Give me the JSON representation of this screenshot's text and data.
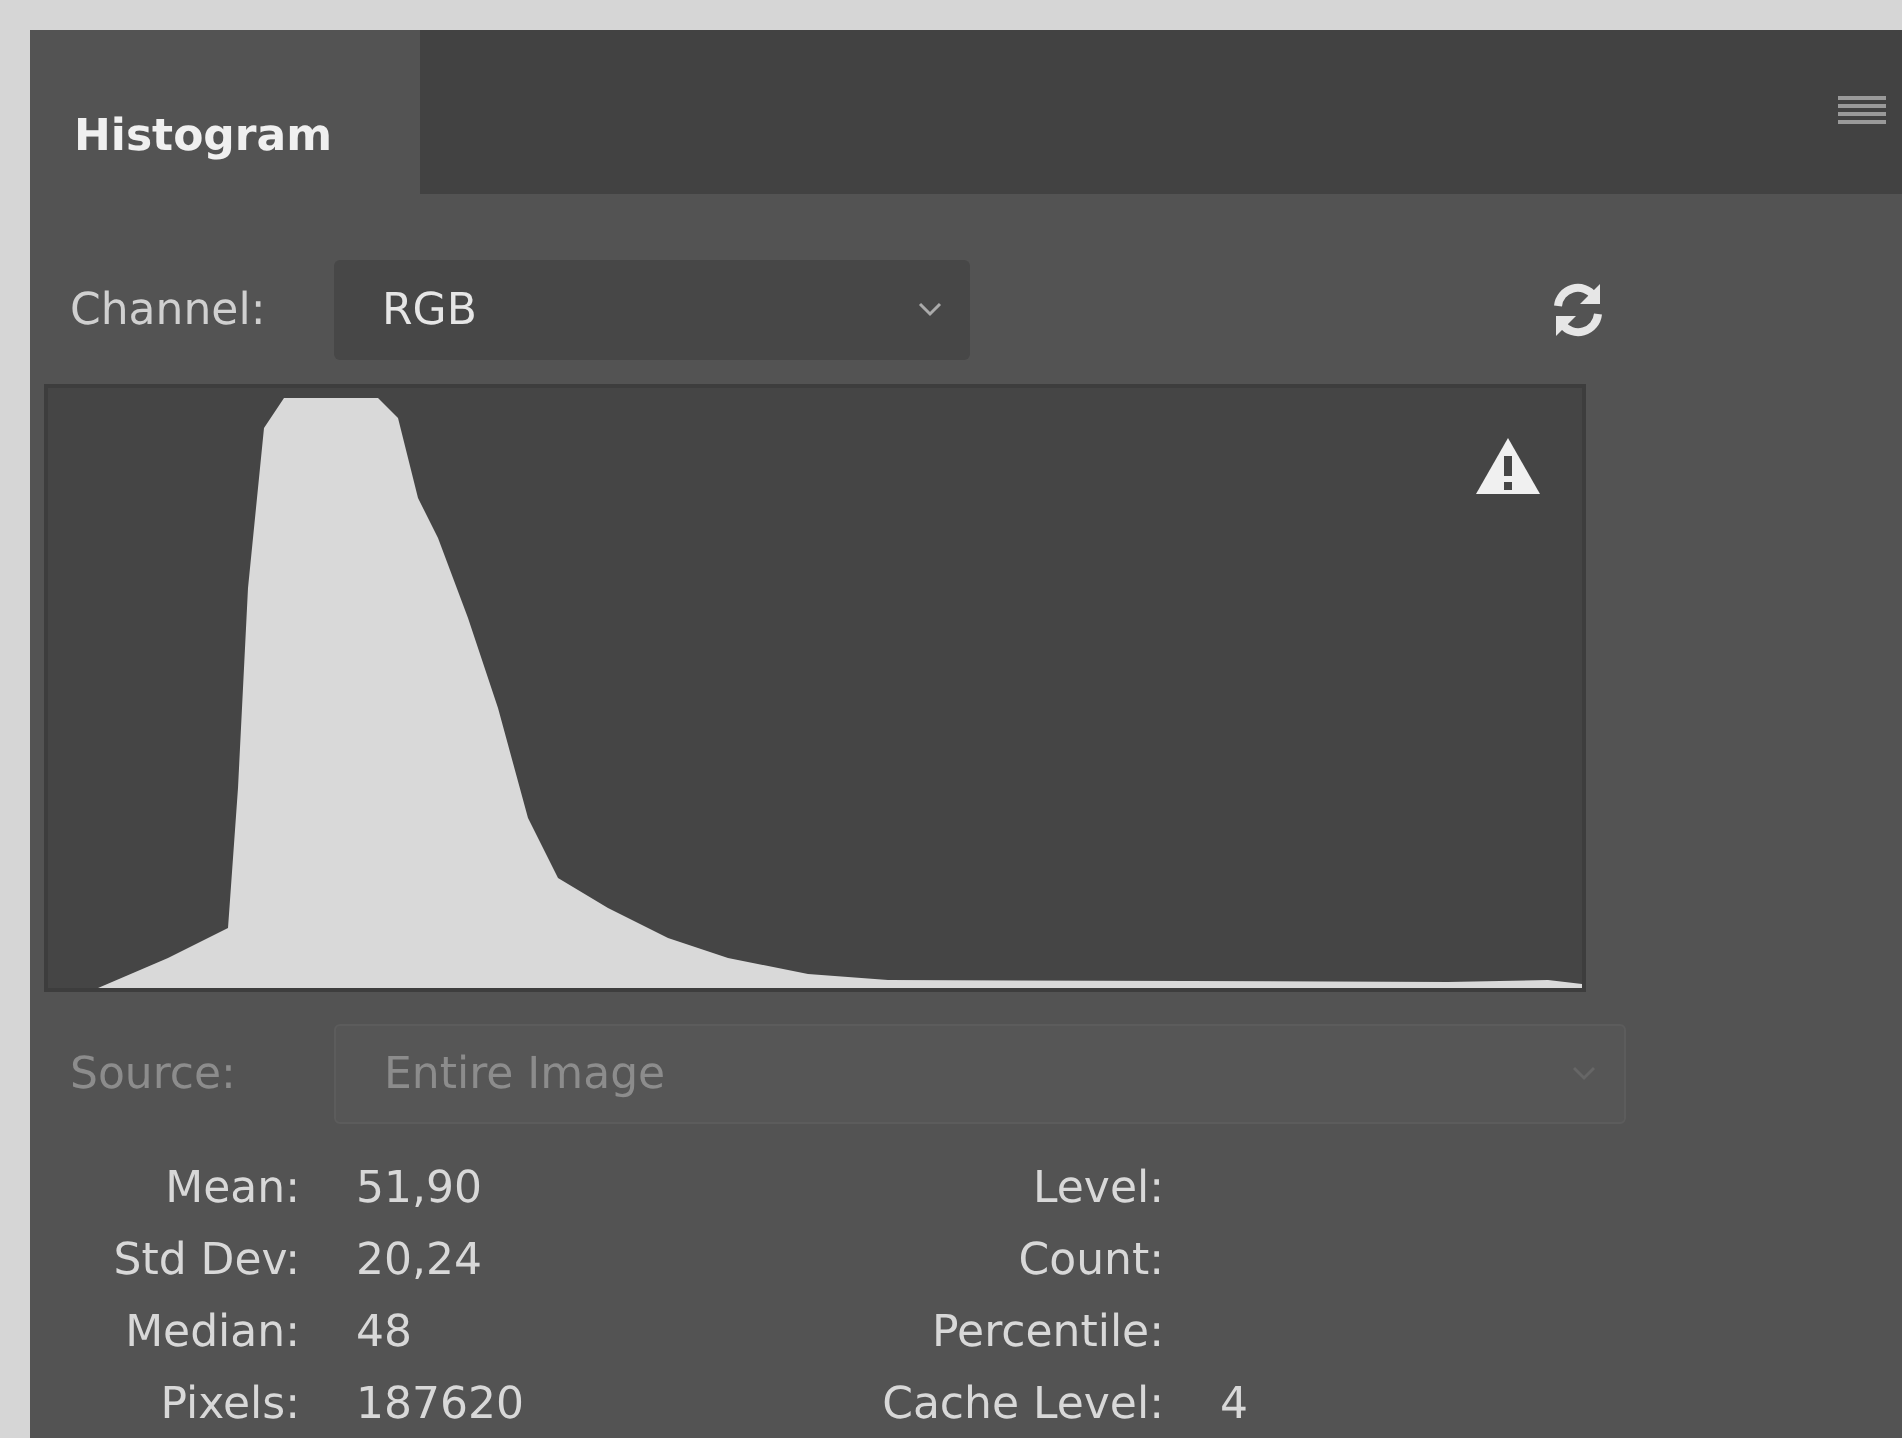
{
  "panel": {
    "tab": "Histogram"
  },
  "channel": {
    "label": "Channel:",
    "value": "RGB"
  },
  "source": {
    "label": "Source:",
    "value": "Entire Image",
    "disabled": true
  },
  "stats_left": [
    {
      "label": "Mean:",
      "value": "51,90"
    },
    {
      "label": "Std Dev:",
      "value": "20,24"
    },
    {
      "label": "Median:",
      "value": "48"
    },
    {
      "label": "Pixels:",
      "value": "187620"
    }
  ],
  "stats_right": [
    {
      "label": "Level:"
    },
    {
      "label": "Count:"
    },
    {
      "label": "Percentile:"
    },
    {
      "label": "Cache Level:",
      "value": "4"
    }
  ]
}
